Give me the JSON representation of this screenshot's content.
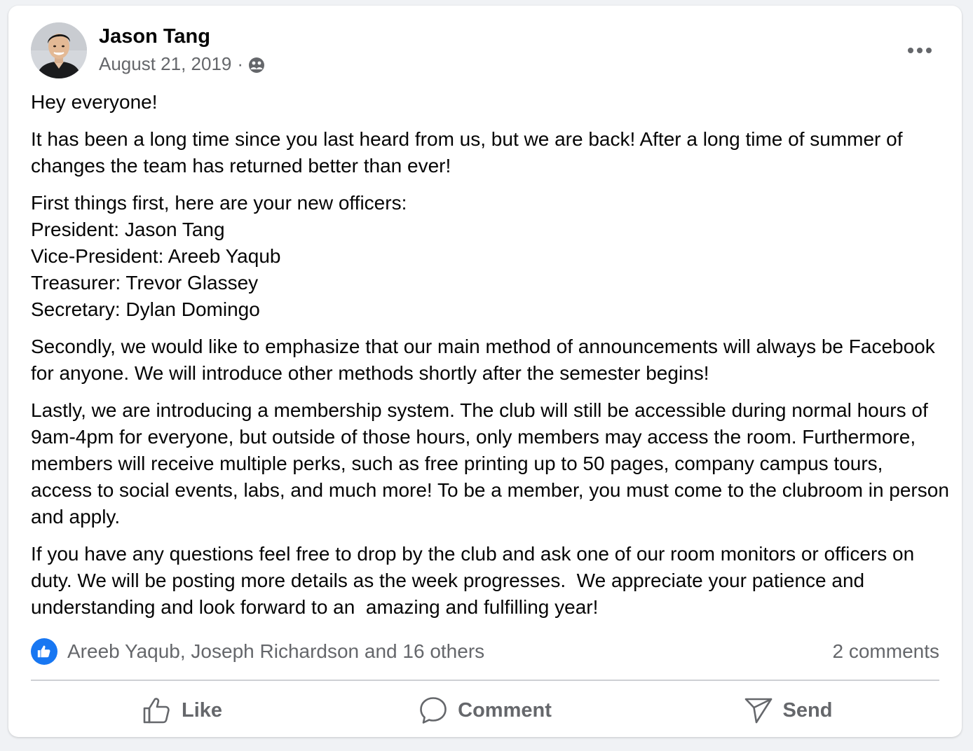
{
  "post": {
    "author": {
      "name": "Jason Tang",
      "avatar_icon": "profile-photo"
    },
    "date": "August 21, 2019",
    "separator": "·",
    "audience_icon": "friends-icon",
    "more_icon": "more-options-icon",
    "paragraphs": [
      "Hey everyone!",
      "It has been a long time since you last heard from us, but we are back! After a long time of summer of changes the team has returned better than ever!",
      "First things first, here are your new officers:\nPresident: Jason Tang\nVice-President: Areeb Yaqub\nTreasurer: Trevor Glassey\nSecretary: Dylan Domingo",
      "Secondly, we would like to emphasize that our main method of announcements will always be Facebook for anyone. We will introduce other methods shortly after the semester begins!",
      "Lastly, we are introducing a membership system. The club will still be accessible during normal hours of 9am-4pm for everyone, but outside of those hours, only members may access the room. Furthermore, members will receive multiple perks, such as free printing up to 50 pages, company campus tours, access to social events, labs, and much more! To be a member, you must come to the clubroom in person and apply.",
      "If you have any questions feel free to drop by the club and ask one of our room monitors or officers on duty. We will be posting more details as the week progresses.  We appreciate your patience and understanding and look forward to an  amazing and fulfilling year!"
    ],
    "reactions": {
      "icon": "like-reaction-icon",
      "text": "Areeb Yaqub, Joseph Richardson and 16 others"
    },
    "comments_count": "2 comments",
    "actions": {
      "like": "Like",
      "comment": "Comment",
      "send": "Send"
    }
  },
  "colors": {
    "page_bg": "#f0f2f5",
    "card_bg": "#ffffff",
    "primary_text": "#050505",
    "secondary_text": "#65676b",
    "accent": "#1877f2",
    "divider": "#ced0d4"
  }
}
